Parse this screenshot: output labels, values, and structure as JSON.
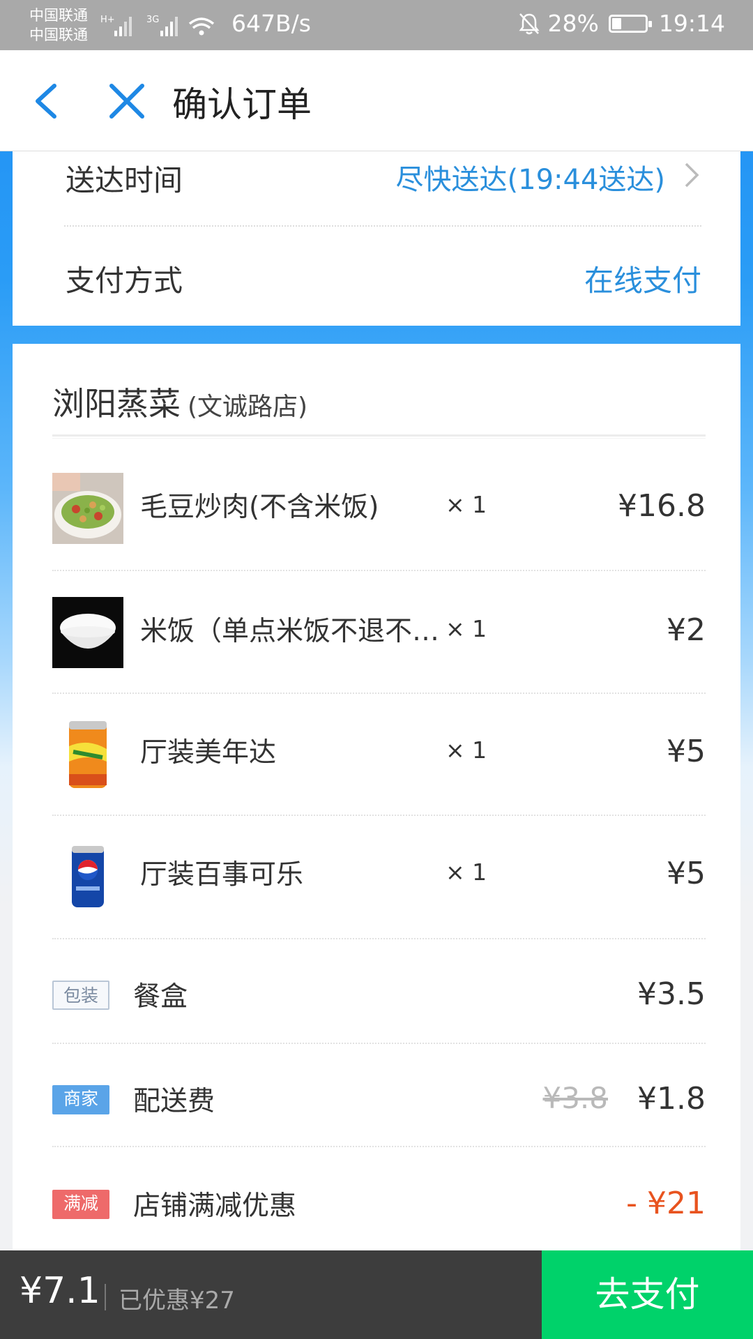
{
  "status_bar": {
    "carrier1": "中国联通",
    "carrier2": "中国联通",
    "net1": "H+",
    "net2": "3G",
    "speed": "647B/s",
    "battery": "28%",
    "time": "19:14"
  },
  "nav": {
    "title": "确认订单"
  },
  "delivery": {
    "time_label": "送达时间",
    "time_value": "尽快送达(19:44送达)",
    "pay_label": "支付方式",
    "pay_value": "在线支付"
  },
  "shop": {
    "name": "浏阳蒸菜",
    "branch": "(文诚路店)"
  },
  "items": [
    {
      "name": "毛豆炒肉(不含米饭)",
      "qty": "× 1",
      "price": "¥16.8",
      "image": "stir-fry-dish"
    },
    {
      "name": "米饭（单点米饭不退不换）",
      "qty": "× 1",
      "price": "¥2",
      "image": "rice-bowl"
    },
    {
      "name": "厅装美年达",
      "qty": "× 1",
      "price": "¥5",
      "image": "mirinda-can"
    },
    {
      "name": "厅装百事可乐",
      "qty": "× 1",
      "price": "¥5",
      "image": "pepsi-can"
    }
  ],
  "fees": {
    "packaging": {
      "tag": "包装",
      "name": "餐盒",
      "price": "¥3.5"
    },
    "delivery": {
      "tag": "商家",
      "name": "配送费",
      "old_price": "¥3.8",
      "price": "¥1.8"
    },
    "discount": {
      "tag": "满减",
      "name": "店铺满减优惠",
      "price": "- ¥21"
    }
  },
  "footer": {
    "total": "¥7.1",
    "saved": "已优惠¥27",
    "pay_button": "去支付"
  },
  "colors": {
    "accent": "#2a8fdc",
    "pay_green": "#00d26a",
    "discount_red": "#e8531f"
  }
}
